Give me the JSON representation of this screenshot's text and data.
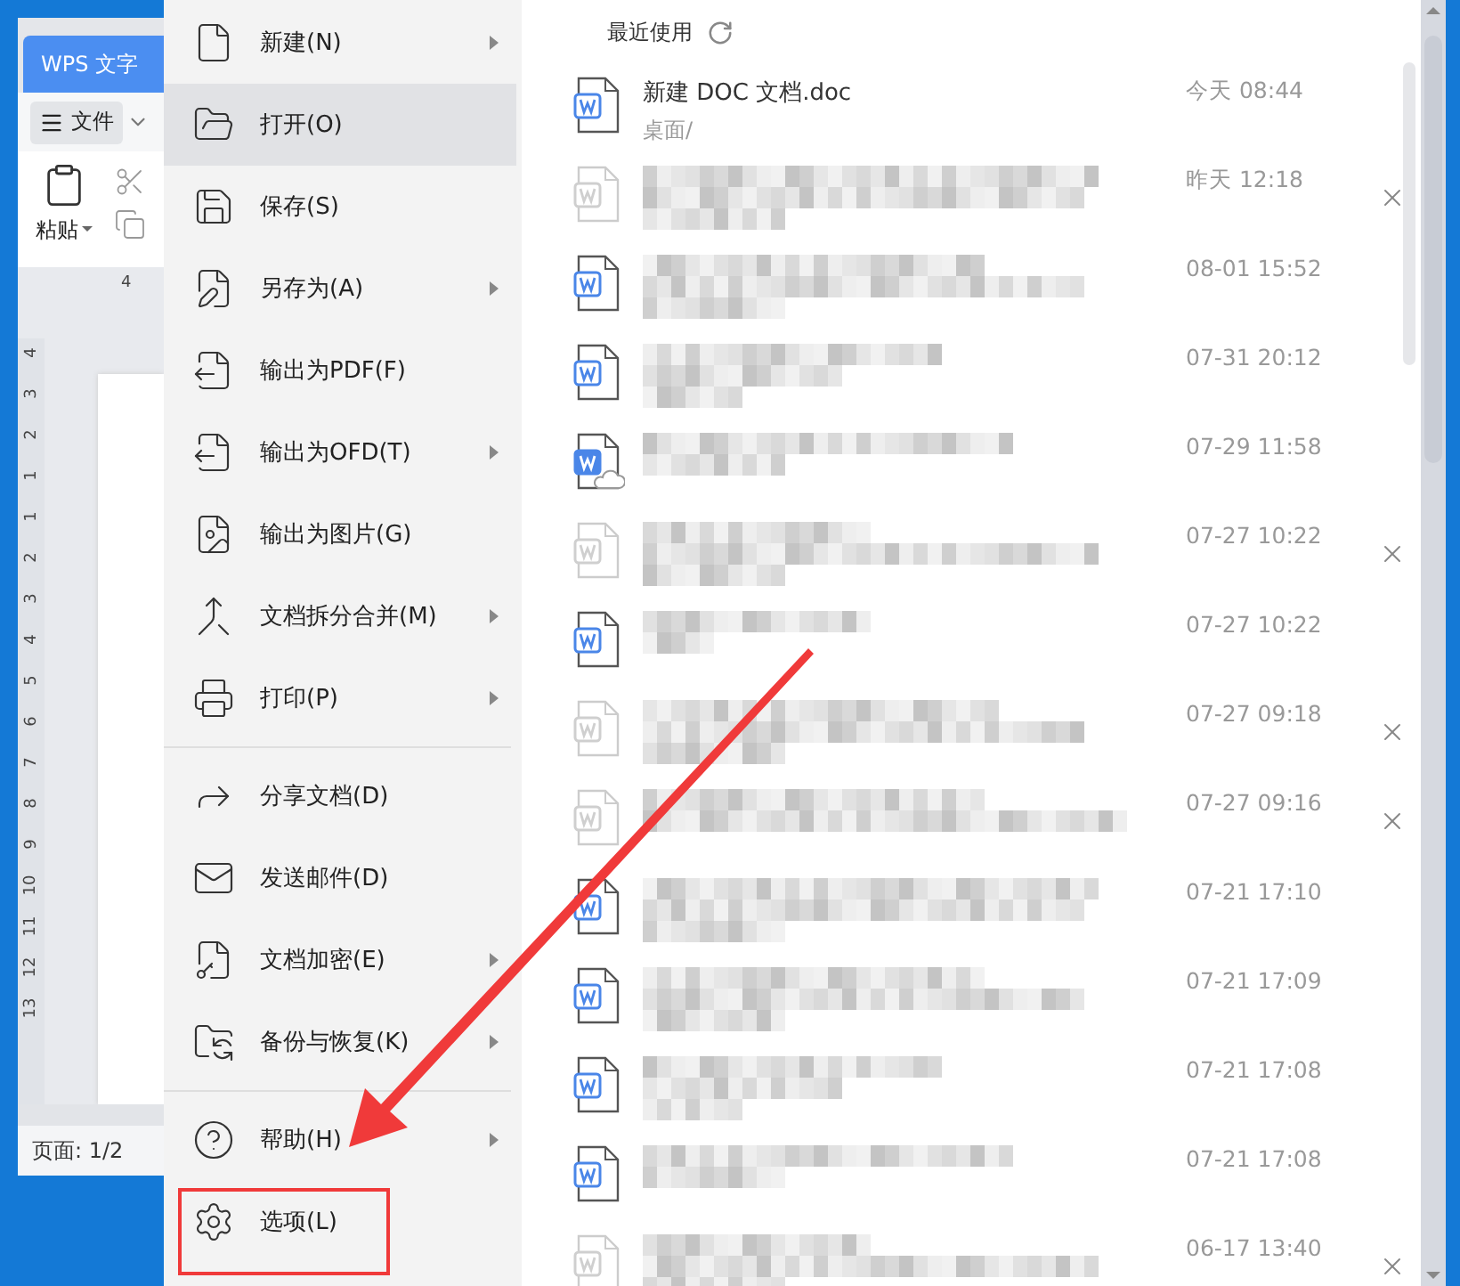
{
  "document_window": {
    "app_tab": "WPS 文字",
    "file_button": "文件",
    "paste_label": "粘贴",
    "top_ruler_mark": "4",
    "ruler_numbers": [
      "4",
      "3",
      "2",
      "1",
      "1",
      "2",
      "3",
      "4",
      "5",
      "6",
      "7",
      "8",
      "9",
      "10",
      "11",
      "12",
      "13"
    ],
    "status": "页面: 1/2"
  },
  "file_menu": {
    "sections": [
      {
        "items": [
          {
            "label": "新建(N)",
            "submenu": true,
            "selected": false
          },
          {
            "label": "打开(O)",
            "submenu": false,
            "selected": true
          },
          {
            "label": "保存(S)",
            "submenu": false,
            "selected": false
          },
          {
            "label": "另存为(A)",
            "submenu": true,
            "selected": false
          },
          {
            "label": "输出为PDF(F)",
            "submenu": false,
            "selected": false
          },
          {
            "label": "输出为OFD(T)",
            "submenu": true,
            "selected": false
          },
          {
            "label": "输出为图片(G)",
            "submenu": false,
            "selected": false
          },
          {
            "label": "文档拆分合并(M)",
            "submenu": true,
            "selected": false
          },
          {
            "label": "打印(P)",
            "submenu": true,
            "selected": false
          }
        ]
      },
      {
        "items": [
          {
            "label": "分享文档(D)",
            "submenu": false,
            "selected": false
          },
          {
            "label": "发送邮件(D)",
            "submenu": false,
            "selected": false
          },
          {
            "label": "文档加密(E)",
            "submenu": true,
            "selected": false
          },
          {
            "label": "备份与恢复(K)",
            "submenu": true,
            "selected": false
          }
        ]
      },
      {
        "items": [
          {
            "label": "帮助(H)",
            "submenu": true,
            "selected": false
          },
          {
            "label": "选项(L)",
            "submenu": false,
            "selected": false
          }
        ]
      }
    ]
  },
  "recent": {
    "title": "最近使用",
    "files": [
      {
        "name": "新建 DOC 文档.doc",
        "path": "桌面/",
        "time": "今天  08:44",
        "missing": false,
        "cloud": false
      },
      {
        "time": "昨天  12:18",
        "missing": true,
        "cloud": false
      },
      {
        "time": "08-01 15:52",
        "missing": false,
        "cloud": false
      },
      {
        "time": "07-31 20:12",
        "missing": false,
        "cloud": false
      },
      {
        "time": "07-29 11:58",
        "missing": false,
        "cloud": true
      },
      {
        "time": "07-27 10:22",
        "missing": true,
        "cloud": false
      },
      {
        "time": "07-27 10:22",
        "missing": false,
        "cloud": false
      },
      {
        "time": "07-27 09:18",
        "missing": true,
        "cloud": false
      },
      {
        "time": "07-27 09:16",
        "missing": true,
        "cloud": false
      },
      {
        "time": "07-21 17:10",
        "missing": false,
        "cloud": false
      },
      {
        "time": "07-21 17:09",
        "missing": false,
        "cloud": false
      },
      {
        "time": "07-21 17:08",
        "missing": false,
        "cloud": false
      },
      {
        "time": "07-21 17:08",
        "missing": false,
        "cloud": false
      },
      {
        "time": "06-17 13:40",
        "missing": true,
        "cloud": false
      }
    ]
  }
}
